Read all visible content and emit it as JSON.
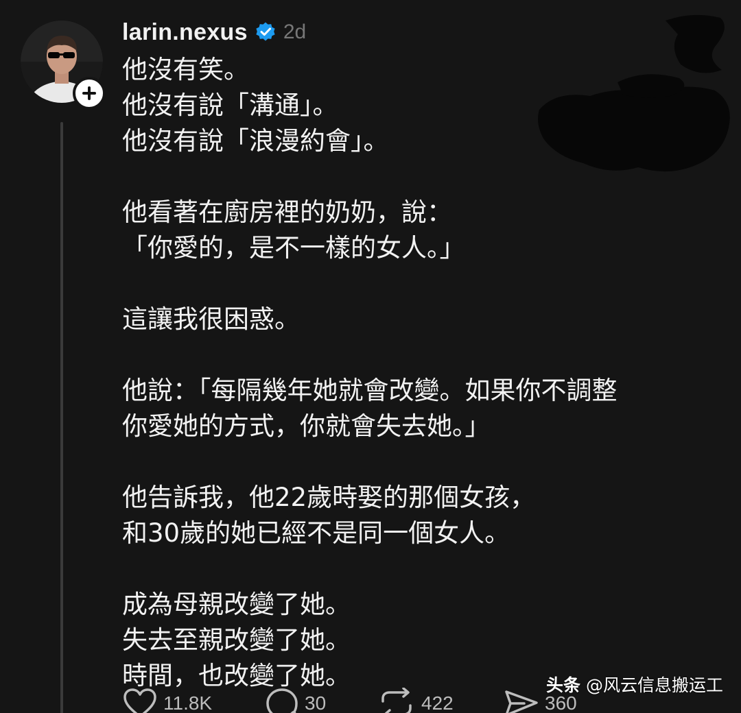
{
  "post": {
    "author": {
      "username": "larin.nexus",
      "verified": true,
      "avatar_icon": "profile-photo-man-sunglasses"
    },
    "timestamp": "2d",
    "follow_icon": "plus-icon",
    "body_lines": [
      "他沒有笑。",
      "他沒有說「溝通」。",
      "他沒有說「浪漫約會」。",
      "",
      "他看著在廚房裡的奶奶，說：",
      "「你愛的，是不一樣的女人。」",
      "",
      "這讓我很困惑。",
      "",
      "他說：「每隔幾年她就會改變。如果你不調整",
      "你愛她的方式，你就會失去她。」",
      "",
      "他告訴我，他22歲時娶的那個女孩，",
      "和30歲的她已經不是同一個女人。",
      "",
      "成為母親改變了她。",
      "失去至親改變了她。",
      "時間，也改變了她。"
    ],
    "actions": {
      "likes": "11.8K",
      "replies": "30",
      "reposts": "422",
      "shares": "360"
    }
  },
  "watermark": {
    "brand": "头条",
    "handle": "@风云信息搬运工"
  },
  "colors": {
    "background": "#151515",
    "text": "#f2f2f2",
    "muted": "#777777",
    "verified_blue": "#1d9bf0",
    "redaction": "#070707"
  }
}
